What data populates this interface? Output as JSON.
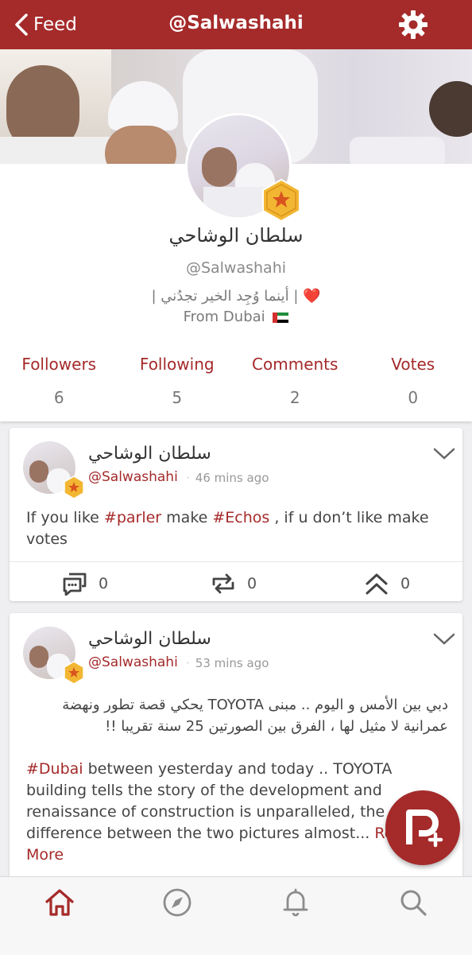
{
  "nav": {
    "back_label": "Feed",
    "title": "@Salwashahi"
  },
  "profile": {
    "display_name": "سلطان الوشاحي",
    "handle": "@Salwashahi",
    "bio_line1": "| أينما وُجِد الخير تجدُني | ❤️",
    "bio_line2": "From Dubai",
    "stats": [
      {
        "label": "Followers",
        "value": "6"
      },
      {
        "label": "Following",
        "value": "5"
      },
      {
        "label": "Comments",
        "value": "2"
      },
      {
        "label": "Votes",
        "value": "0"
      }
    ]
  },
  "posts": [
    {
      "author": "سلطان الوشاحي",
      "handle": "@Salwashahi",
      "time": "46 mins ago",
      "text_parts": [
        "If you like ",
        "#parler",
        " make ",
        "#Echos",
        " , if u don’t like make votes"
      ],
      "comments": "0",
      "echoes": "0",
      "votes": "0"
    },
    {
      "author": "سلطان الوشاحي",
      "handle": "@Salwashahi",
      "time": "53 mins ago",
      "arabic_text": "دبي بين الأمس و اليوم .. مبنى TOYOTA يحكي قصة تطور ونهضة عمرانية لا مثيل لها ، الفرق بين الصورتين 25 سنة تقريبا !!",
      "hashtag": "#Dubai",
      "english_text": " between yesterday and today .. TOYOTA building tells the story of the development and renaissance of construction is unparalleled, the difference between the two pictures almost... ",
      "read_more": "Read More"
    }
  ],
  "colors": {
    "brand": "#a52a2a",
    "background": "#efeff1",
    "badge": "#f2b632"
  },
  "icons": [
    "chevron-left-icon",
    "gear-icon",
    "star-badge-icon",
    "comment-icon",
    "echo-icon",
    "upvote-icon",
    "chevron-down-icon",
    "parler-compose-icon",
    "home-icon",
    "compass-icon",
    "bell-icon",
    "search-icon"
  ]
}
